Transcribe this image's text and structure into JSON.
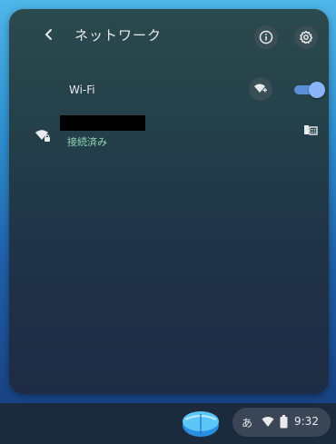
{
  "header": {
    "title": "ネットワーク",
    "back_icon": "chevron-left-icon",
    "info_icon": "info-icon",
    "settings_icon": "gear-icon"
  },
  "wifi": {
    "label": "Wi-Fi",
    "add_network_icon": "wifi-add-icon",
    "enabled": true
  },
  "networks": [
    {
      "name_redacted": true,
      "status": "接続済み",
      "signal_icon": "wifi-locked-icon",
      "detail_icon": "network-detail-icon"
    }
  ],
  "shelf": {
    "launcher_icon": "launcher-icon",
    "ime": "あ",
    "wifi_icon": "wifi-icon",
    "battery_icon": "battery-icon",
    "time": "9:32"
  },
  "colors": {
    "panel_bg": "#233e49",
    "accent": "#8ab4f8",
    "status_green": "#8fd4b0",
    "text": "#e8eaed"
  }
}
